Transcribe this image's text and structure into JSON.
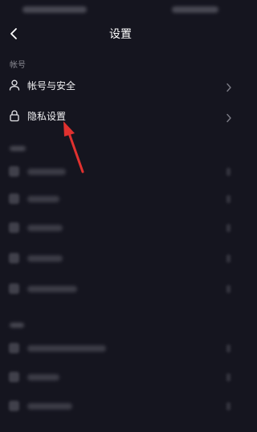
{
  "header": {
    "title": "设置"
  },
  "sections": [
    {
      "label": "帐号",
      "items": [
        {
          "label": "帐号与安全",
          "icon": "user-icon"
        },
        {
          "label": "隐私设置",
          "icon": "lock-icon"
        }
      ]
    }
  ],
  "colors": {
    "background": "#15151f",
    "text": "#ffffff",
    "muted": "#8a8a93",
    "annotation": "#e0312f"
  }
}
